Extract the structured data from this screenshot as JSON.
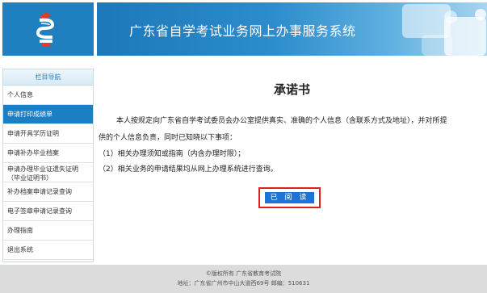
{
  "header": {
    "title": "广东省自学考试业务网上办事服务系统",
    "logo_icon": "exam-logo-icon",
    "brand_color": "#1f7fbf"
  },
  "sidebar": {
    "heading": "栏目导航",
    "items": [
      {
        "label": "个人信息"
      },
      {
        "label": "申请打印成绩单",
        "active": true
      },
      {
        "label": "申请开具学历证明"
      },
      {
        "label": "申请补办毕业档案"
      },
      {
        "label": "申请办理毕业证遗失证明",
        "label_line2": "（毕业证明书）"
      },
      {
        "label": "补办档案申请记录查询"
      },
      {
        "label": "电子签章申请记录查询"
      },
      {
        "label": "办理指南"
      },
      {
        "label": "退出系统"
      }
    ]
  },
  "main": {
    "title": "承诺书",
    "paragraph_1": "本人按规定向广东省自学考试委员会办公室提供真实、准确的个人信息（含联系方式及地址），并对所提",
    "paragraph_2": "供的个人信息负责，同时已知晓以下事项：",
    "item_1": "（1）相关办理须知或指南（内含办理时限）；",
    "item_2": "（2）相关业务的申请结果均从网上办理系统进行查询。",
    "read_button": "已 阅 读"
  },
  "footer": {
    "copyright": "©版权所有  广东省教育考试院",
    "address": "地址：广东省广州市中山大道西69号 邮编：510631"
  }
}
